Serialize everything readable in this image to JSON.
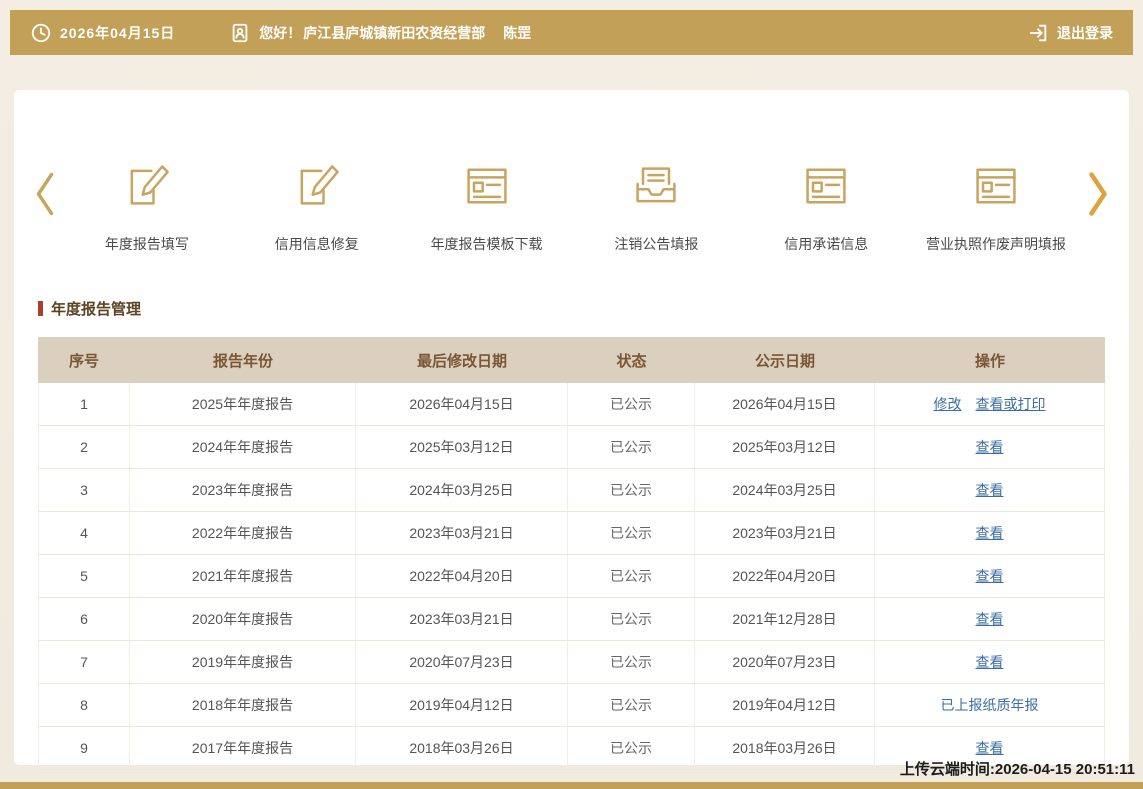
{
  "header": {
    "date": "2026年04月15日",
    "greeting": "您好！",
    "company": "庐江县庐城镇新田农资经营部",
    "user": "陈罡",
    "logout": "退出登录"
  },
  "carousel": {
    "items": [
      {
        "label": "年度报告填写",
        "icon": "edit"
      },
      {
        "label": "信用信息修复",
        "icon": "repair"
      },
      {
        "label": "年度报告模板下载",
        "icon": "template"
      },
      {
        "label": "注销公告填报",
        "icon": "inbox"
      },
      {
        "label": "信用承诺信息",
        "icon": "promise"
      },
      {
        "label": "营业执照作废声明填报",
        "icon": "license"
      }
    ]
  },
  "section": {
    "title": "年度报告管理"
  },
  "table": {
    "headers": [
      "序号",
      "报告年份",
      "最后修改日期",
      "状态",
      "公示日期",
      "操作"
    ],
    "rows": [
      {
        "no": "1",
        "year": "2025年年度报告",
        "modified": "2026年04月15日",
        "status": "已公示",
        "published": "2026年04月15日",
        "actions": [
          {
            "label": "修改",
            "type": "link"
          },
          {
            "label": "查看或打印",
            "type": "link"
          }
        ]
      },
      {
        "no": "2",
        "year": "2024年年度报告",
        "modified": "2025年03月12日",
        "status": "已公示",
        "published": "2025年03月12日",
        "actions": [
          {
            "label": "查看",
            "type": "link"
          }
        ]
      },
      {
        "no": "3",
        "year": "2023年年度报告",
        "modified": "2024年03月25日",
        "status": "已公示",
        "published": "2024年03月25日",
        "actions": [
          {
            "label": "查看",
            "type": "link"
          }
        ]
      },
      {
        "no": "4",
        "year": "2022年年度报告",
        "modified": "2023年03月21日",
        "status": "已公示",
        "published": "2023年03月21日",
        "actions": [
          {
            "label": "查看",
            "type": "link"
          }
        ]
      },
      {
        "no": "5",
        "year": "2021年年度报告",
        "modified": "2022年04月20日",
        "status": "已公示",
        "published": "2022年04月20日",
        "actions": [
          {
            "label": "查看",
            "type": "link"
          }
        ]
      },
      {
        "no": "6",
        "year": "2020年年度报告",
        "modified": "2023年03月21日",
        "status": "已公示",
        "published": "2021年12月28日",
        "actions": [
          {
            "label": "查看",
            "type": "link"
          }
        ]
      },
      {
        "no": "7",
        "year": "2019年年度报告",
        "modified": "2020年07月23日",
        "status": "已公示",
        "published": "2020年07月23日",
        "actions": [
          {
            "label": "查看",
            "type": "link"
          }
        ]
      },
      {
        "no": "8",
        "year": "2018年年度报告",
        "modified": "2019年04月12日",
        "status": "已公示",
        "published": "2019年04月12日",
        "actions": [
          {
            "label": "已上报纸质年报",
            "type": "text"
          }
        ]
      },
      {
        "no": "9",
        "year": "2017年年度报告",
        "modified": "2018年03月26日",
        "status": "已公示",
        "published": "2018年03月26日",
        "actions": [
          {
            "label": "查看",
            "type": "link"
          }
        ]
      }
    ]
  },
  "footer": {
    "upload_time": "上传云端时间:2026-04-15 20:51:11"
  },
  "colors": {
    "gold": "#c3a057",
    "icon_gold": "#c9a45f",
    "table_header_bg": "#dbcfc0",
    "table_header_text": "#7a5632",
    "link_blue": "#3a6ea5",
    "marker_red": "#a8402c"
  }
}
